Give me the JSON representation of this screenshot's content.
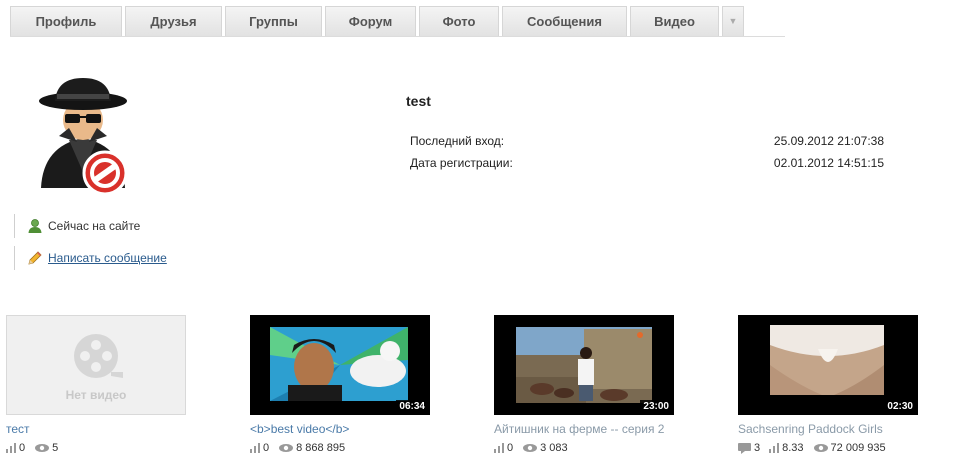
{
  "menu": {
    "tabs": [
      {
        "label": "Профиль",
        "id": "profile"
      },
      {
        "label": "Друзья",
        "id": "friends"
      },
      {
        "label": "Группы",
        "id": "groups"
      },
      {
        "label": "Форум",
        "id": "forum"
      },
      {
        "label": "Фото",
        "id": "photo"
      },
      {
        "label": "Сообщения",
        "id": "messages"
      },
      {
        "label": "Видео",
        "id": "video"
      }
    ],
    "more_icon": "chevron-down-icon"
  },
  "profile": {
    "username": "test",
    "last_login_label": "Последний вход:",
    "last_login_value": "25.09.2012 21:07:38",
    "reg_label": "Дата регистрации:",
    "reg_value": "02.01.2012 14:51:15",
    "online_text": "Сейчас на сайте",
    "write_message": "Написать сообщение",
    "avatar_icon": "spy-banned-avatar"
  },
  "videos": [
    {
      "title": "тест",
      "no_video_text": "Нет видео",
      "ratings": "0",
      "views": "5",
      "duration": ""
    },
    {
      "title": "<b>best video</b>",
      "ratings": "0",
      "views": "8 868 895",
      "duration": "06:34"
    },
    {
      "title": "Айтишник на ферме -- серия 2",
      "ratings": "0",
      "views": "3 083",
      "duration": "23:00"
    },
    {
      "title": "Sachsenring Paddock Girls",
      "comments": "3",
      "ratings": "8.33",
      "views": "72 009 935",
      "duration": "02:30"
    }
  ],
  "colors": {
    "link": "#2a5b8d",
    "video_title": "#4a7aa8",
    "tab_bg": "#e6e6e6"
  }
}
